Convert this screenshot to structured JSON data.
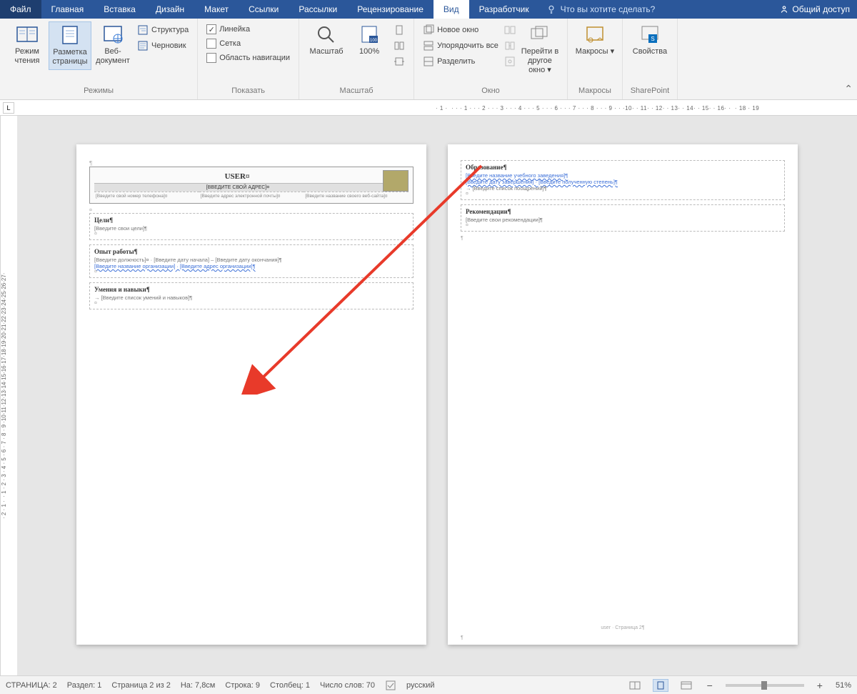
{
  "menubar": {
    "tabs": [
      "Файл",
      "Главная",
      "Вставка",
      "Дизайн",
      "Макет",
      "Ссылки",
      "Рассылки",
      "Рецензирование",
      "Вид",
      "Разработчик"
    ],
    "active": "Вид",
    "tell_me": "Что вы хотите сделать?",
    "share": "Общий доступ"
  },
  "ribbon": {
    "views": {
      "label": "Режимы",
      "items": [
        "Режим чтения",
        "Разметка страницы",
        "Веб-документ",
        "Структура",
        "Черновик"
      ]
    },
    "show": {
      "label": "Показать",
      "ruler": "Линейка",
      "grid": "Сетка",
      "nav": "Область навигации",
      "ruler_checked": true
    },
    "zoom": {
      "label": "Масштаб",
      "zoom_btn": "Масштаб",
      "hundred": "100%"
    },
    "window": {
      "label": "Окно",
      "neww": "Новое окно",
      "arr": "Упорядочить все",
      "split": "Разделить",
      "switch1": "Перейти в",
      "switch2": "другое окно"
    },
    "macros": {
      "label": "Макросы",
      "btn": "Макросы"
    },
    "sp": {
      "label": "SharePoint",
      "btn": "Свойства"
    }
  },
  "document": {
    "page1": {
      "title": "USER¤",
      "addr": "[ВВЕДИТЕ СВОЙ АДРЕС]¤",
      "c1": "[Введите свой номер телефона]¤",
      "c2": "[Введите адрес электронной почты]¤",
      "c3": "[Введите название своего веб-сайта]¤",
      "s1": {
        "h": "Цели¶",
        "p": "[Введите свои цели]¶"
      },
      "s2": {
        "h": "Опыт работы¶",
        "p1": "[Введите должность]¤ · [Введите дату начала] – [Введите дату окончания]¶",
        "p2": "[Введите название организации] · [Введите адрес организации]¶"
      },
      "s3": {
        "h": "Умения и навыки¶",
        "p": "→ [Введите список умений и навыков]¶"
      }
    },
    "page2": {
      "s1": {
        "h": "Образование¶",
        "p1": "[Введите название учебного заведения]¶",
        "p2": "[Введите дату завершения] · [Введите полученную степень]¶",
        "p3": "→ [Введите список поощрений]¶"
      },
      "s2": {
        "h": "Рекомендации¶",
        "p": "[Введите свои рекомендации]¶"
      },
      "footer": "user · Страница 2¶"
    }
  },
  "status": {
    "page": "СТРАНИЦА: 2",
    "section": "Раздел: 1",
    "pageof": "Страница 2 из 2",
    "at": "На: 7,8см",
    "line": "Строка: 9",
    "col": "Столбец: 1",
    "words": "Число слов: 70",
    "lang": "русский",
    "zoom": "51%"
  }
}
